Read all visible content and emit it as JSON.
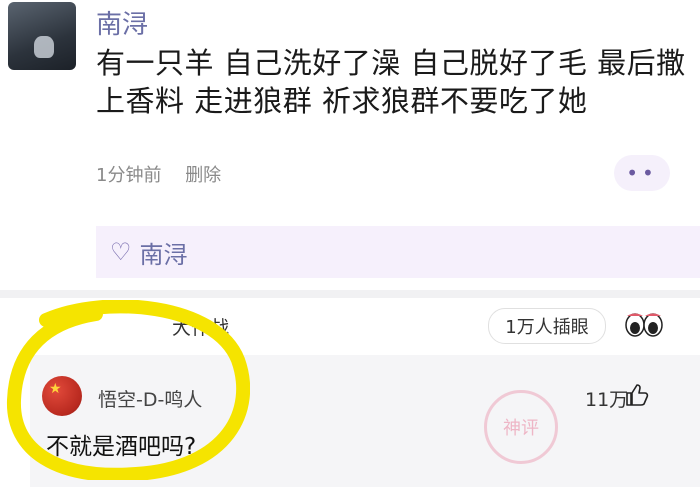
{
  "post": {
    "username": "南浔",
    "content": "有一只羊 自己洗好了澡 自己脱好了毛 最后撒上香料 走进狼群 祈求狼群不要吃了她",
    "time_ago": "1分钟前",
    "delete_label": "删除",
    "more_label": "••"
  },
  "likes": {
    "heart_icon": "♡",
    "liker_name": "南浔"
  },
  "topic": {
    "title_partial": "大作战",
    "views_label": "1万人插眼"
  },
  "comment": {
    "username": "悟空-D-鸣人",
    "likes_count": "11万",
    "text": "不就是酒吧吗?",
    "stamp_text": "神评"
  },
  "colors": {
    "name_color": "#6b6fa6",
    "highlight_color": "#f5e400",
    "like_box_bg": "#f6f0fc"
  }
}
